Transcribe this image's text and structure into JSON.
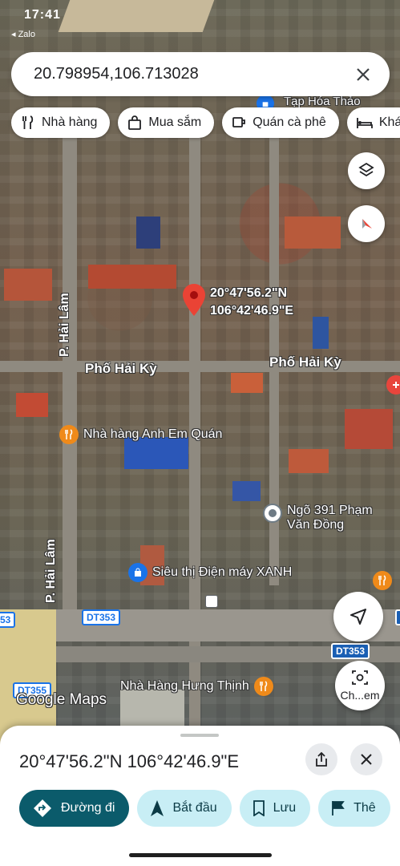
{
  "status_bar": {
    "time": "17:41",
    "app_label": "◂ Zalo"
  },
  "search": {
    "query": "20.798954,106.713028"
  },
  "chips": [
    {
      "label": "Nhà hàng",
      "icon": "restaurant-icon"
    },
    {
      "label": "Mua sắm",
      "icon": "shopping-bag-icon"
    },
    {
      "label": "Quán cà phê",
      "icon": "coffee-icon"
    },
    {
      "label": "Khá",
      "icon": "bed-icon"
    }
  ],
  "map": {
    "pin_coords_line1": "20°47'56.2\"N",
    "pin_coords_line2": "106°42'46.9\"E",
    "labels": {
      "tap_hoa": "Tạp Hóa Thảo",
      "pho_hai_ky_1": "Phố Hải Kỳ",
      "pho_hai_ky_2": "Phố Hải Kỳ",
      "p_hai_lam_1": "P. Hải Lâm",
      "p_hai_lam_2": "P. Hải Lâm",
      "nha_hang_anh_em": "Nhà hàng Anh Em Quán",
      "ngo_391_l1": "Ngõ 391 Phạm",
      "ngo_391_l2": "Văn Đồng",
      "sieu_thi": "Siêu thị Điện máy XANH",
      "nha_hang_hung_thinh": "Nhà Hàng Hưng Thịnh",
      "google_maps": "Google Maps",
      "dt353_a": "DT353",
      "dt353_b": "DT353",
      "dt355": "DT355",
      "edge_53": "53",
      "edge_3": "3",
      "change_em": "Ch...em"
    }
  },
  "sheet": {
    "coordinates": "20°47'56.2\"N 106°42'46.9\"E",
    "actions": [
      {
        "label": "Đường đi"
      },
      {
        "label": "Bắt đầu"
      },
      {
        "label": "Lưu"
      },
      {
        "label": "Thê"
      }
    ]
  },
  "colors": {
    "accent": "#0b5b6b",
    "chip_bg": "#c8eef5",
    "pin": "#ea4335"
  }
}
